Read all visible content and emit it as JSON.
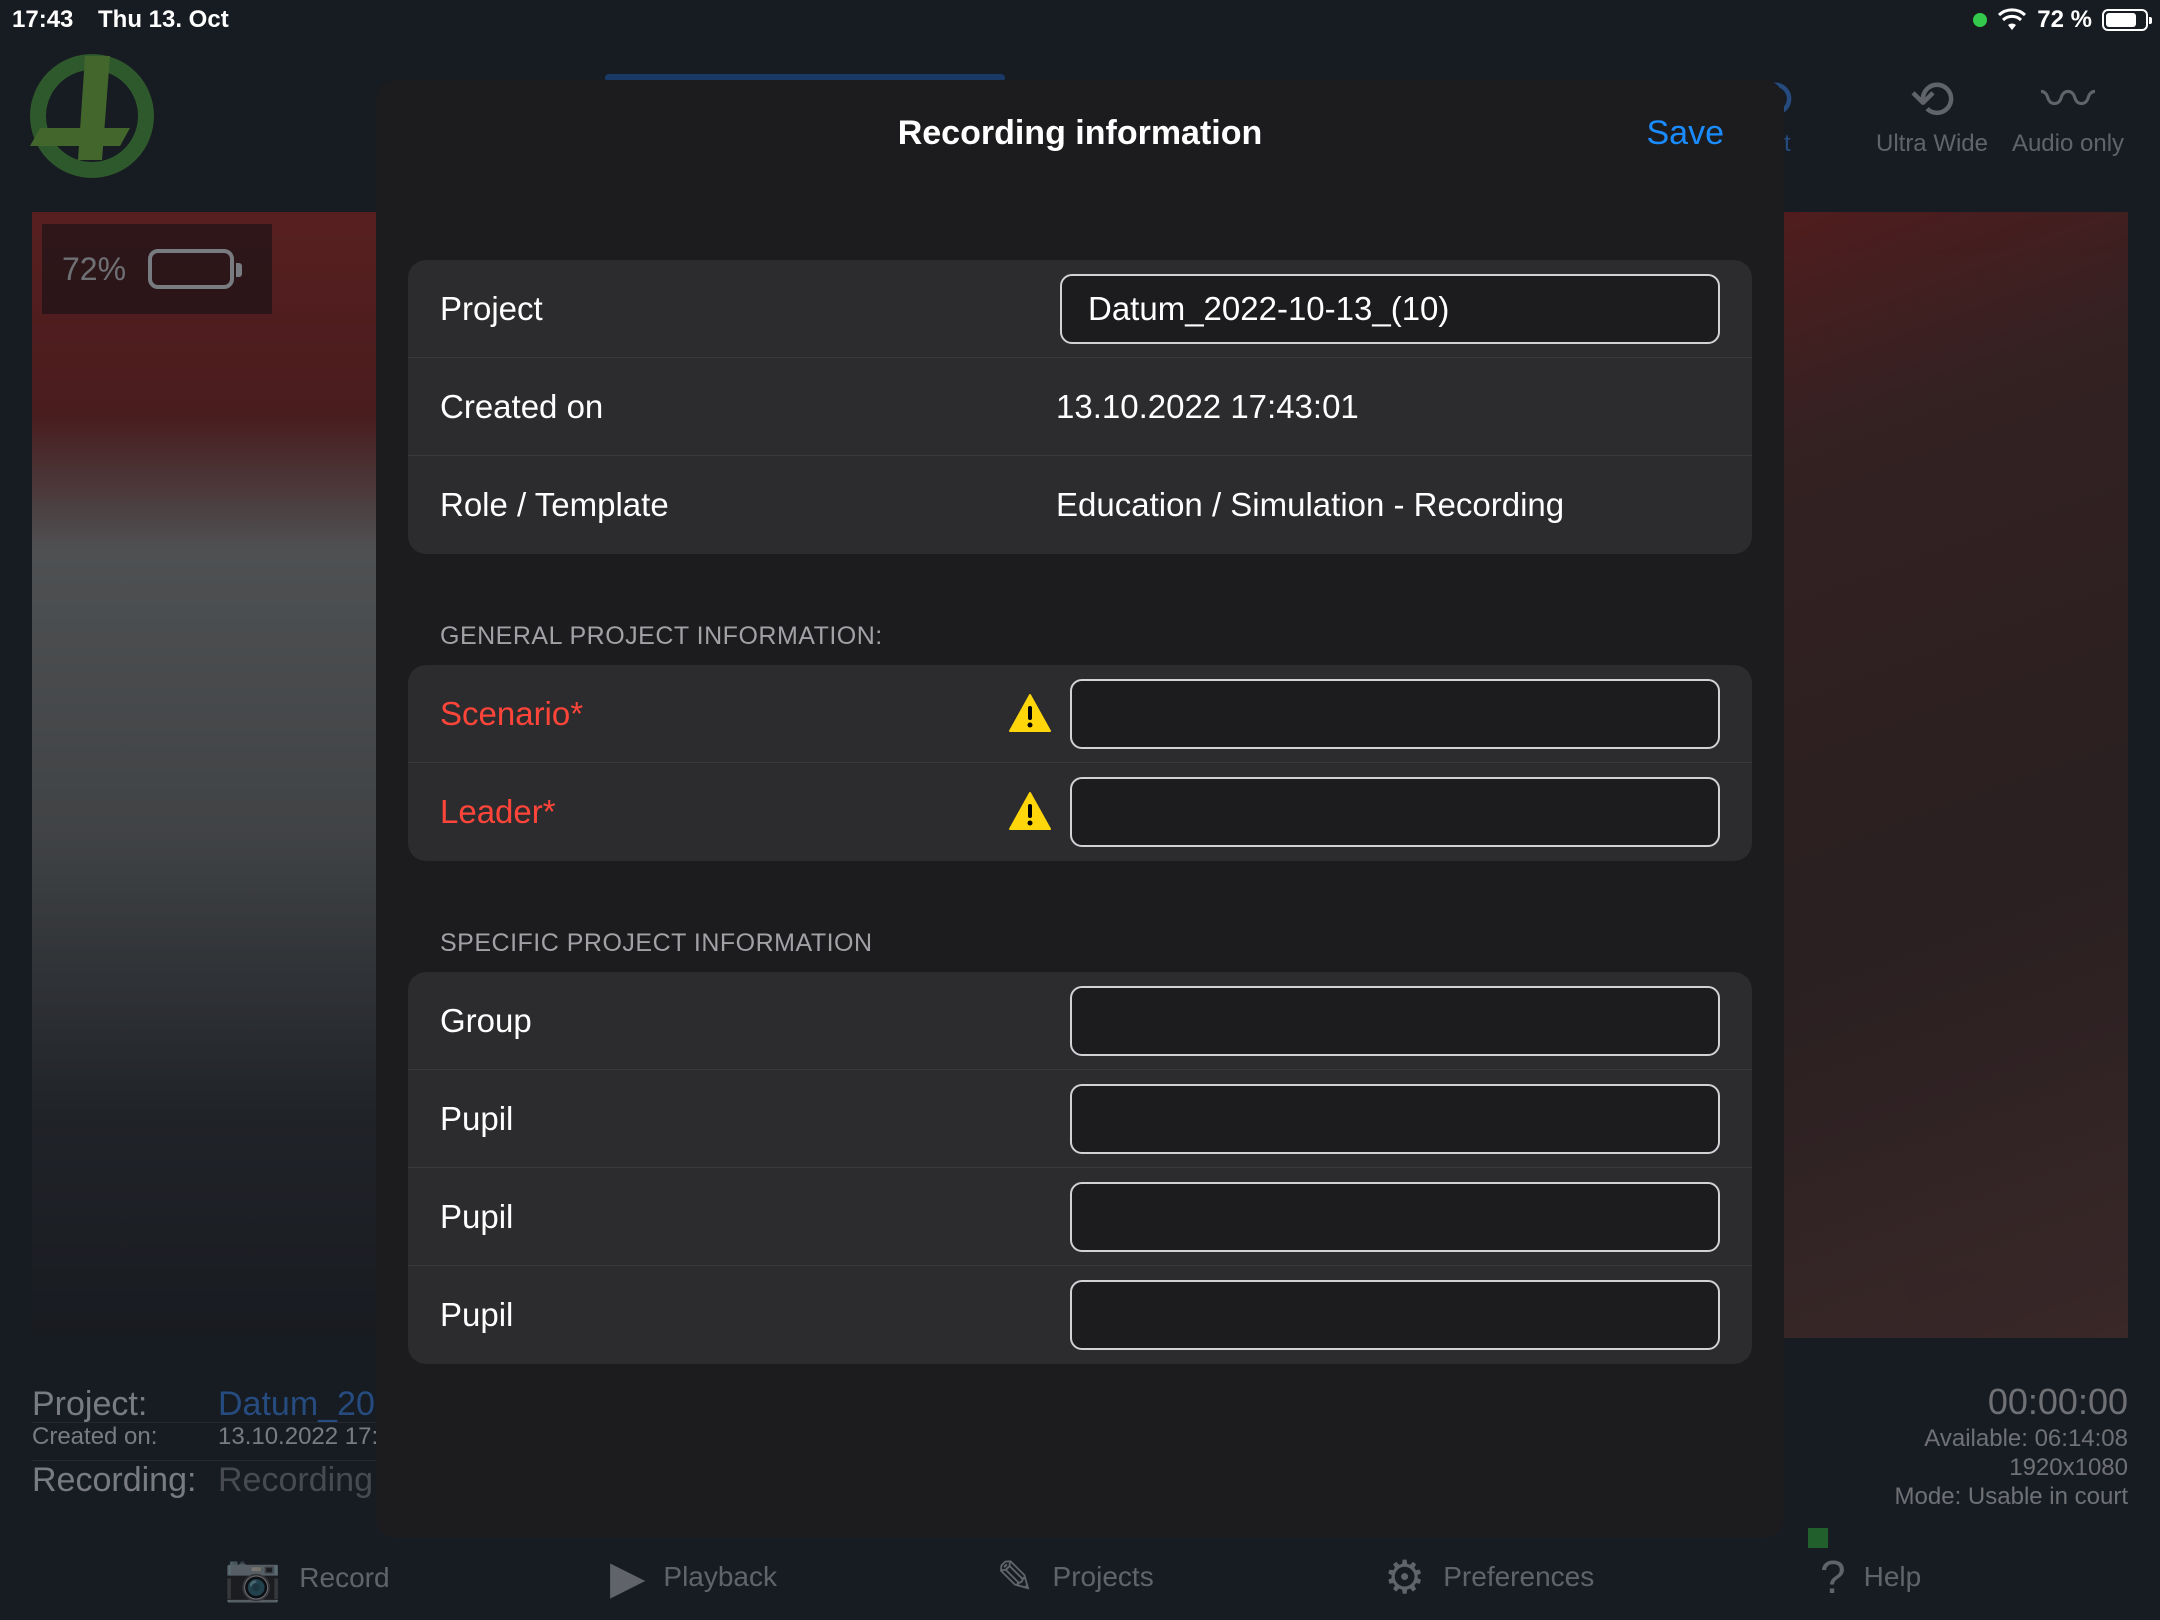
{
  "status_bar": {
    "time": "17:43",
    "date": "Thu 13. Oct",
    "battery": "72 %"
  },
  "background": {
    "camera_modes": [
      {
        "label": "ront",
        "icon": "camera-rotate-icon"
      },
      {
        "label": "Ultra Wide",
        "icon": "camera-rotate-icon"
      },
      {
        "label": "Audio only",
        "icon": "waveform-mic-icon"
      }
    ],
    "battery_overlay": "72%",
    "project_label": "Project:",
    "project_value": "Datum_20",
    "created_label": "Created on:",
    "created_value": "13.10.2022 17:",
    "recording_label": "Recording:",
    "recording_value": "Recording",
    "timer": "00:00:00",
    "available": "Available: 06:14:08",
    "resolution": "1920x1080",
    "mode": "Mode: Usable in court",
    "tabs": [
      {
        "label": "Record",
        "icon": "camera-icon"
      },
      {
        "label": "Playback",
        "icon": "play-icon"
      },
      {
        "label": "Projects",
        "icon": "pencil-icon"
      },
      {
        "label": "Preferences",
        "icon": "gear-icon"
      },
      {
        "label": "Help",
        "icon": "help-icon"
      }
    ]
  },
  "modal": {
    "title": "Recording information",
    "save_label": "Save",
    "summary": {
      "project_label": "Project",
      "project_value": "Datum_2022-10-13_(10)",
      "created_label": "Created on",
      "created_value": "13.10.2022 17:43:01",
      "role_label": "Role / Template",
      "role_value": "Education / Simulation - Recording"
    },
    "general_header": "GENERAL PROJECT INFORMATION:",
    "general_fields": [
      {
        "label": "Scenario*",
        "value": ""
      },
      {
        "label": "Leader*",
        "value": ""
      }
    ],
    "specific_header": "SPECIFIC PROJECT INFORMATION",
    "specific_fields": [
      {
        "label": "Group",
        "value": ""
      },
      {
        "label": "Pupil",
        "value": ""
      },
      {
        "label": "Pupil",
        "value": ""
      },
      {
        "label": "Pupil",
        "value": ""
      }
    ]
  },
  "colors": {
    "accent": "#1a8cff",
    "required": "#ff453a",
    "warning": "#ffd60a",
    "modal_bg": "#1c1c1e",
    "group_bg": "#2c2c2e"
  }
}
